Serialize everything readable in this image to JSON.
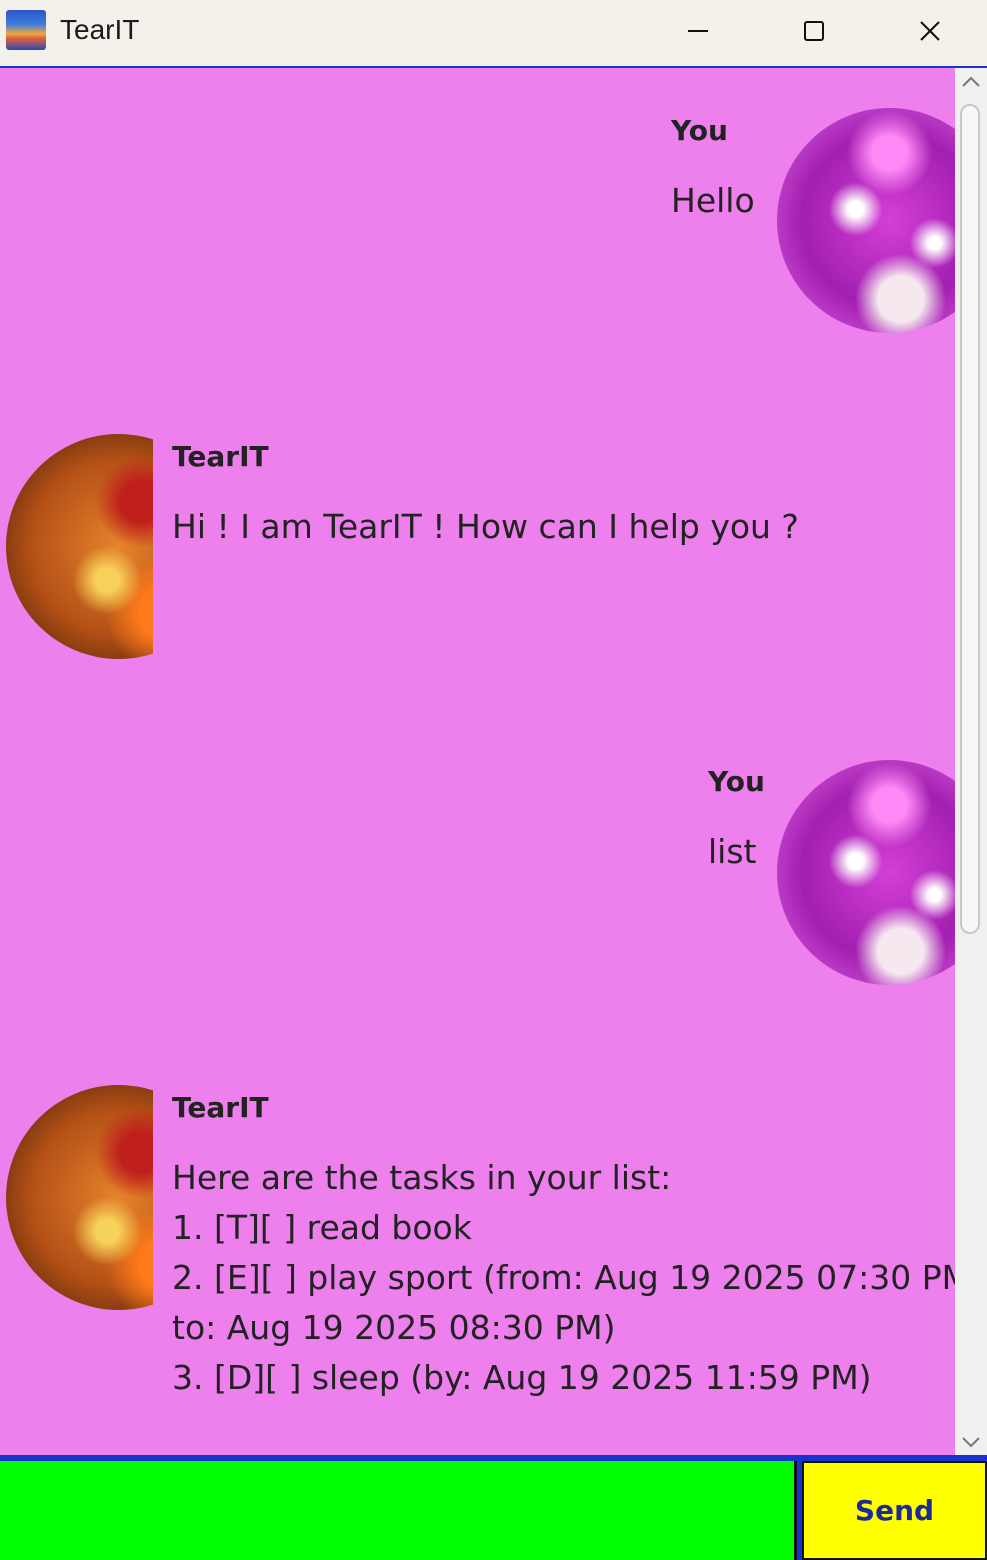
{
  "window": {
    "title": "TearIT",
    "icon": "app-icon",
    "controls": [
      "minimize-icon",
      "maximize-icon",
      "close-icon"
    ]
  },
  "messages": [
    {
      "sender": "You",
      "text": "Hello",
      "avatar": "user-avatar"
    },
    {
      "sender": "TearIT",
      "text": "Hi ! I am TearIT ! How can I help you ?",
      "avatar": "bot-avatar"
    },
    {
      "sender": "You",
      "text": "list",
      "avatar": "user-avatar"
    },
    {
      "sender": "TearIT",
      "text": "Here are the tasks in your list:\n1. [T][ ] read book\n2. [E][ ] play sport (from: Aug 19 2025 07:30 PM\nto: Aug 19 2025 08:30 PM)\n3. [D][ ] sleep (by: Aug 19 2025 11:59 PM)",
      "avatar": "bot-avatar"
    }
  ],
  "input": {
    "value": "",
    "placeholder": ""
  },
  "send_label": "Send",
  "colors": {
    "chat_background": "#ee80ee",
    "input_background": "#00ff00",
    "send_background": "#ffff00",
    "border": "#1733c9"
  }
}
